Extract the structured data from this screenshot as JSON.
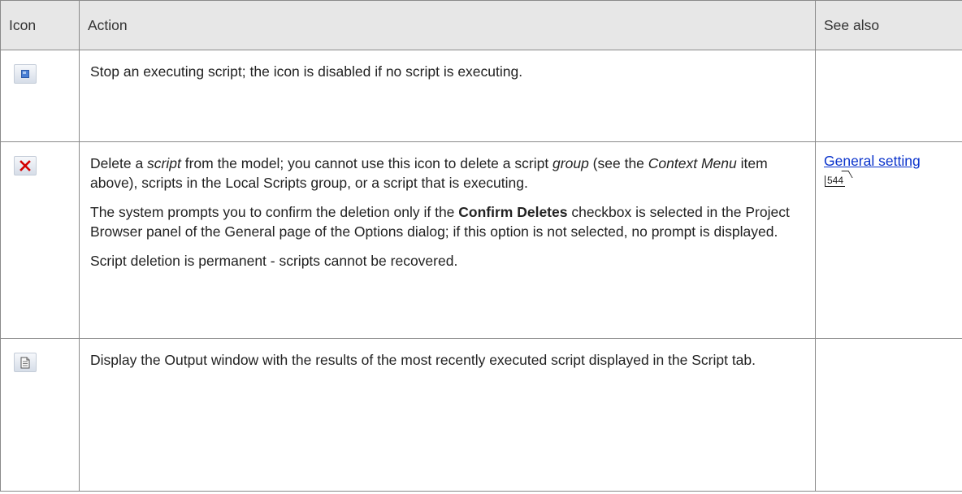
{
  "header": {
    "col_icon": "Icon",
    "col_action": "Action",
    "col_see_also": "See also"
  },
  "rows": [
    {
      "icon": "stop-icon",
      "paragraphs": [
        "Stop an executing script; the icon is disabled if no script is executing."
      ],
      "see_also": ""
    },
    {
      "icon": "delete-icon",
      "p1": {
        "t1": "Delete a ",
        "em1": "script",
        "t2": " from the model; you cannot use this icon to delete a script ",
        "em2": "group",
        "t3": " (see the ",
        "em3": "Context Menu",
        "t4": " item above), scripts in the Local Scripts group, or a script that is executing."
      },
      "p2": {
        "t1": "The system prompts you to confirm the deletion only if the ",
        "bold": "Confirm Deletes",
        "t2": " checkbox is selected  in the Project Browser panel of the General page of the Options dialog; if this option is not selected, no prompt is displayed."
      },
      "p3": "Script deletion is permanent - scripts cannot be recovered.",
      "see_also": {
        "link": "General setting",
        "page": "544"
      }
    },
    {
      "icon": "output-icon",
      "paragraphs": [
        "Display the Output window with the results of the most recently executed script displayed in the Script tab."
      ],
      "see_also": ""
    }
  ],
  "colors": {
    "header_bg": "#e7e7e7",
    "border": "#8a8a8a",
    "link": "#0a33cc",
    "delete_red": "#d40000"
  }
}
